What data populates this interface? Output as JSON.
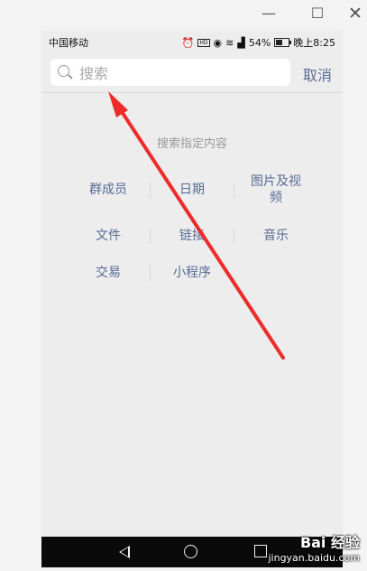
{
  "window": {
    "minimize_icon": "minimize-icon",
    "maximize_icon": "maximize-icon",
    "close_icon": "close-icon"
  },
  "statusbar": {
    "carrier": "中国移动",
    "battery": "54%",
    "time": "晚上8:25",
    "battery_level": 0.54
  },
  "search": {
    "placeholder": "搜索",
    "cancel": "取消"
  },
  "hint": "搜索指定内容",
  "categories": {
    "row1": [
      "群成员",
      "日期",
      "图片及视\n频"
    ],
    "row2": [
      "文件",
      "链接",
      "音乐"
    ],
    "row3": [
      "交易",
      "小程序"
    ]
  },
  "nav": {
    "back_icon": "back-icon",
    "home_icon": "home-icon",
    "recent_icon": "recent-apps-icon"
  },
  "watermark": {
    "logo": "Bai 经验",
    "url": "jingyan.baidu.com"
  },
  "colors": {
    "link": "#576b95",
    "hint": "#9a9a9a",
    "arrow": "#ee2b2b"
  }
}
